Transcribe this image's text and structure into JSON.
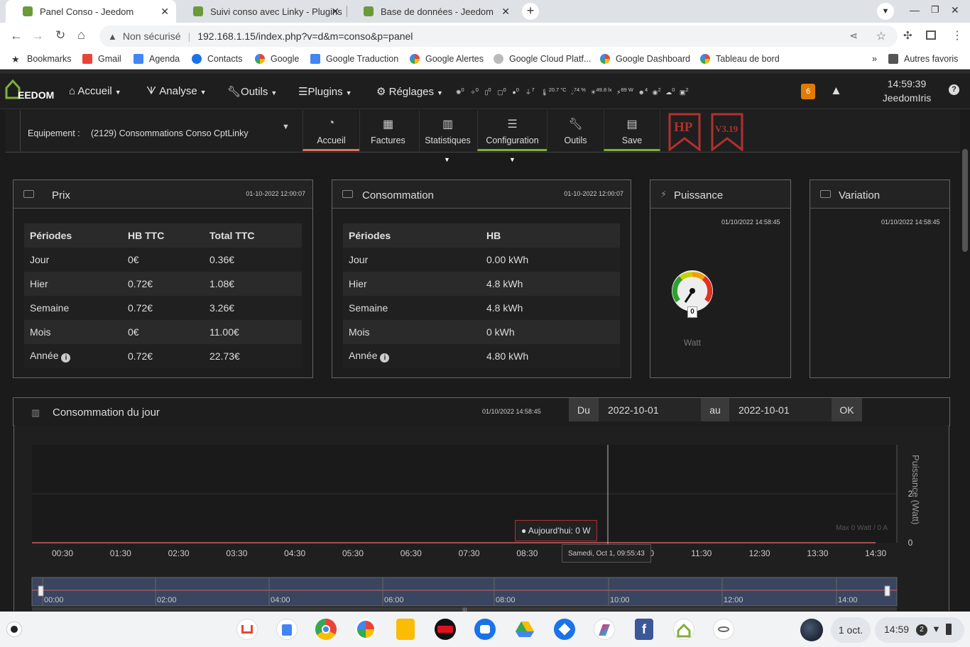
{
  "browser": {
    "tabs": [
      {
        "title": "Panel Conso - Jeedom",
        "active": true
      },
      {
        "title": "Suivi conso avec Linky - Plugins",
        "active": false
      },
      {
        "title": "Base de données - Jeedom",
        "active": false
      }
    ],
    "url_security": "Non sécurisé",
    "url": "192.168.1.15/index.php?v=d&m=conso&p=panel",
    "bookmarks": [
      "Bookmarks",
      "Gmail",
      "Agenda",
      "Contacts",
      "Google",
      "Google Traduction",
      "Google Alertes",
      "Google Cloud Platf...",
      "Google Dashboard",
      "Tableau de bord"
    ],
    "other_bookmarks": "Autres favoris"
  },
  "jeedom": {
    "logo": "EEDOM",
    "menu": [
      "Accueil",
      "Analyse",
      "Outils",
      "Plugins",
      "Réglages"
    ],
    "status_items": [
      "0",
      "0",
      "0",
      "0",
      "0",
      "7",
      "20.7 °C",
      "74 %",
      "49.8 lx",
      "89 W",
      "4",
      "2",
      "0",
      "2"
    ],
    "badge": "6",
    "time": "14:59:39",
    "user": "JeedomIris"
  },
  "equip": {
    "label": "Equipement :",
    "value": "(2129) Consommations Conso CptLinky",
    "buttons": [
      "Accueil",
      "Factures",
      "Statistiques",
      "Configuration",
      "Outils",
      "Save"
    ],
    "hp_badge": "HP",
    "version_badge": "V3.19"
  },
  "prix": {
    "title": "Prix",
    "date": "01-10-2022 12:00:07",
    "headers": [
      "Périodes",
      "HB TTC",
      "Total TTC"
    ],
    "rows": [
      [
        "Jour",
        "0€",
        "0.36€"
      ],
      [
        "Hier",
        "0.72€",
        "1.08€"
      ],
      [
        "Semaine",
        "0.72€",
        "3.26€"
      ],
      [
        "Mois",
        "0€",
        "11.00€"
      ],
      [
        "Année",
        "0.72€",
        "22.73€"
      ]
    ]
  },
  "consommation": {
    "title": "Consommation",
    "date": "01-10-2022 12:00:07",
    "headers": [
      "Périodes",
      "HB"
    ],
    "rows": [
      [
        "Jour",
        "0.00 kWh"
      ],
      [
        "Hier",
        "4.8 kWh"
      ],
      [
        "Semaine",
        "4.8 kWh"
      ],
      [
        "Mois",
        "0 kWh"
      ],
      [
        "Année",
        "4.80 kWh"
      ]
    ]
  },
  "puissance": {
    "title": "Puissance",
    "date": "01/10/2022 14:58:45",
    "gauge_value": "0",
    "unit": "Watt"
  },
  "variation": {
    "title": "Variation",
    "date": "01/10/2022 14:58:45"
  },
  "jour": {
    "title": "Consommation du jour",
    "date": "01/10/2022 14:58:45",
    "du_label": "Du",
    "du_value": "2022-10-01",
    "au_label": "au",
    "au_value": "2022-10-01",
    "ok_label": "OK",
    "tooltip": "● Aujourd'hui: 0 W",
    "crosshair_label": "Samedi, Oct 1, 09:55:43",
    "max_label": "Max 0 Watt / 0 A"
  },
  "chart_data": {
    "type": "line",
    "x_ticks": [
      "00:30",
      "01:30",
      "02:30",
      "03:30",
      "04:30",
      "05:30",
      "06:30",
      "07:30",
      "08:30",
      "09:30",
      "10:30",
      "11:30",
      "12:30",
      "13:30",
      "14:30"
    ],
    "ylabel": "Puissance (Watt)",
    "y_ticks": [
      "0",
      "2"
    ],
    "series": [
      {
        "name": "Aujourd'hui",
        "values": [
          0,
          0,
          0,
          0,
          0,
          0,
          0,
          0,
          0,
          0,
          0,
          0,
          0,
          0,
          0
        ]
      }
    ],
    "navigator_ticks": [
      "00:00",
      "02:00",
      "04:00",
      "06:00",
      "08:00",
      "10:00",
      "12:00",
      "14:00"
    ]
  },
  "shelf": {
    "date": "1 oct.",
    "time": "14:59",
    "notif_count": "2"
  }
}
